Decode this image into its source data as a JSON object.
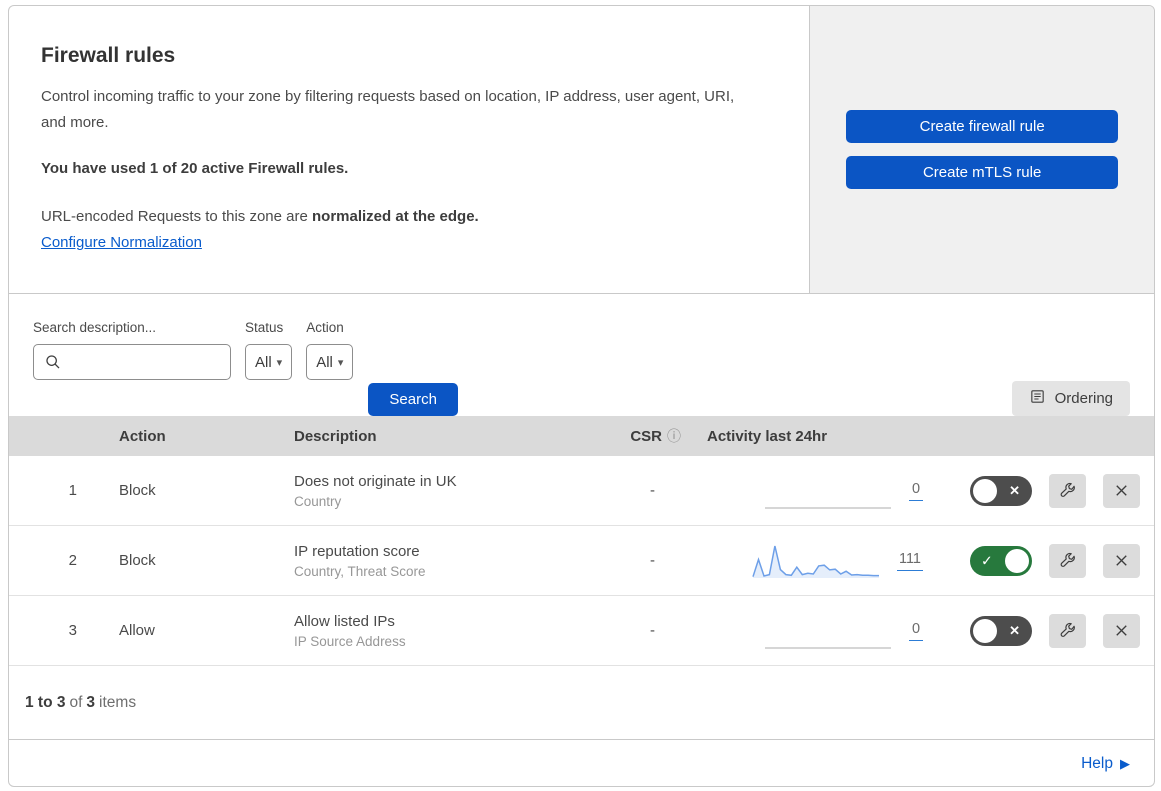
{
  "header": {
    "title": "Firewall rules",
    "description": "Control incoming traffic to your zone by filtering requests based on location, IP address, user agent, URI, and more.",
    "usage": "You have used 1 of 20 active Firewall rules.",
    "normalization_prefix": "URL-encoded Requests to this zone are",
    "normalization_bold": "normalized at the edge.",
    "normalization_link": "Configure Normalization",
    "create_firewall_button": "Create firewall rule",
    "create_mtls_button": "Create mTLS rule"
  },
  "filters": {
    "search_label": "Search description...",
    "status_label": "Status",
    "status_value": "All",
    "action_label": "Action",
    "action_value": "All",
    "search_button": "Search",
    "ordering_button": "Ordering"
  },
  "table": {
    "columns": {
      "action": "Action",
      "description": "Description",
      "csr": "CSR",
      "activity": "Activity last 24hr"
    },
    "rows": [
      {
        "index": "1",
        "action": "Block",
        "description": "Does not originate in UK",
        "fields": "Country",
        "csr": "-",
        "activity_count": "0",
        "enabled": false,
        "sparkline": [
          0,
          0,
          0,
          0,
          0,
          0,
          0,
          0,
          0,
          0,
          0,
          0,
          0,
          0,
          0,
          0,
          0,
          0,
          0,
          0,
          0,
          0,
          0,
          0
        ]
      },
      {
        "index": "2",
        "action": "Block",
        "description": "IP reputation score",
        "fields": "Country, Threat Score",
        "csr": "-",
        "activity_count": "111",
        "enabled": true,
        "sparkline": [
          4,
          55,
          6,
          10,
          95,
          25,
          10,
          8,
          32,
          10,
          14,
          12,
          36,
          38,
          24,
          26,
          12,
          20,
          9,
          10,
          8,
          8,
          7,
          7
        ]
      },
      {
        "index": "3",
        "action": "Allow",
        "description": "Allow listed IPs",
        "fields": "IP Source Address",
        "csr": "-",
        "activity_count": "0",
        "enabled": false,
        "sparkline": [
          0,
          0,
          0,
          0,
          0,
          0,
          0,
          0,
          0,
          0,
          0,
          0,
          0,
          0,
          0,
          0,
          0,
          0,
          0,
          0,
          0,
          0,
          0,
          0
        ]
      }
    ]
  },
  "footer": {
    "range": "1 to 3",
    "of_text": "of",
    "total": "3",
    "items_text": "items",
    "help_label": "Help"
  },
  "icons": {
    "info": "ⓘ",
    "dropdown_arrow": "▾",
    "toggle_check": "✓",
    "toggle_cross": "✕",
    "help_arrow": "▶"
  },
  "colors": {
    "accent_blue": "#0b55c4",
    "link_blue": "#0a5ccc",
    "toggle_on_green": "#27793d",
    "toggle_off_gray": "#4d4d4d",
    "header_gray": "#dadada",
    "panel_gray": "#f0f0f0",
    "sparkline_line": "#6d9fe8",
    "sparkline_fill": "rgba(109,159,232,0.18)",
    "sparkline_flat": "#c9c9c9"
  }
}
